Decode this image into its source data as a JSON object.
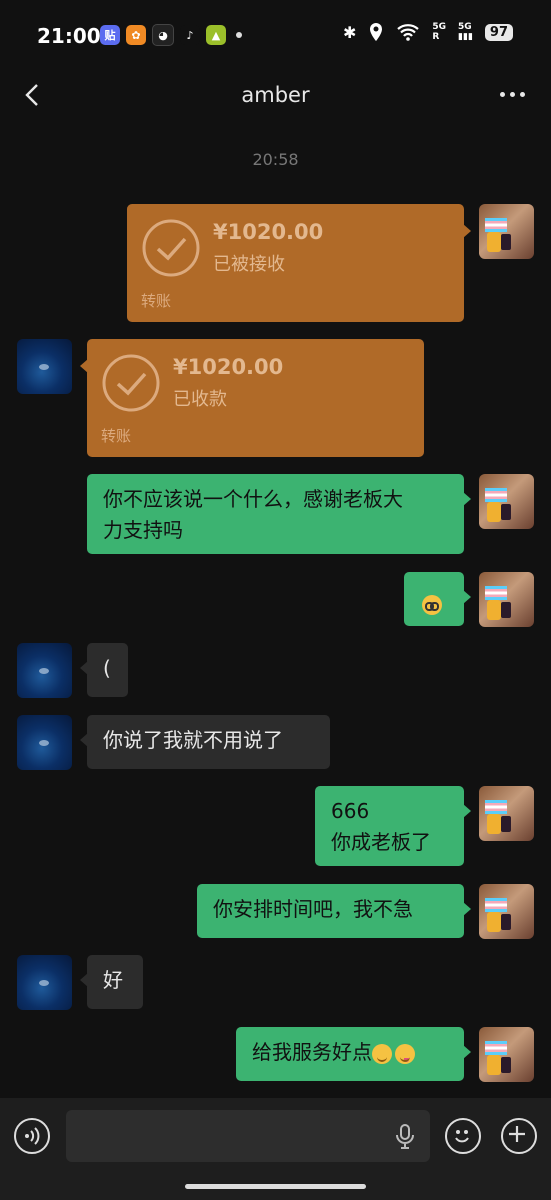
{
  "status_bar": {
    "time": "21:00",
    "app_icons": [
      {
        "name": "tieba-icon",
        "label": "贴",
        "color": "#5b6cf0"
      },
      {
        "name": "taobao-icon",
        "label": "",
        "color": "#f08a24"
      },
      {
        "name": "qq-icon",
        "label": "",
        "color": "#222222"
      },
      {
        "name": "tiktok-icon",
        "label": "",
        "color": "#111111"
      },
      {
        "name": "game-icon",
        "label": "",
        "color": "#9bbf2a"
      }
    ],
    "network_5g": "5G",
    "network_5g_2": "5G",
    "roaming": "R",
    "battery": "97"
  },
  "header": {
    "title": "amber"
  },
  "timestamp": "20:58",
  "messages": [
    {
      "side": "right",
      "type": "transfer",
      "amount": "¥1020.00",
      "status": "已被接收",
      "label": "转账"
    },
    {
      "side": "left",
      "type": "transfer",
      "amount": "¥1020.00",
      "status": "已收款",
      "label": "转账"
    },
    {
      "side": "right",
      "type": "text",
      "line1": "你不应该说一个什么，感谢老板大",
      "line2": "力支持吗"
    },
    {
      "side": "right",
      "type": "emoji",
      "emoji": "nerd-face"
    },
    {
      "side": "left",
      "type": "text",
      "text": "("
    },
    {
      "side": "left",
      "type": "text",
      "text": "你说了我就不用说了"
    },
    {
      "side": "right",
      "type": "text",
      "line1": "666",
      "line2": "你成老板了"
    },
    {
      "side": "right",
      "type": "text",
      "text": "你安排时间吧，我不急"
    },
    {
      "side": "left",
      "type": "text",
      "text": "好"
    },
    {
      "side": "right",
      "type": "text",
      "text": "给我服务好点",
      "emojis": [
        "relieved-face",
        "yum-face"
      ]
    }
  ],
  "colors": {
    "background": "#111111",
    "green_bubble": "#3cb371",
    "gray_bubble": "#2c2c2c",
    "transfer_bubble": "#b06a28"
  },
  "input": {
    "value": "",
    "placeholder": ""
  }
}
